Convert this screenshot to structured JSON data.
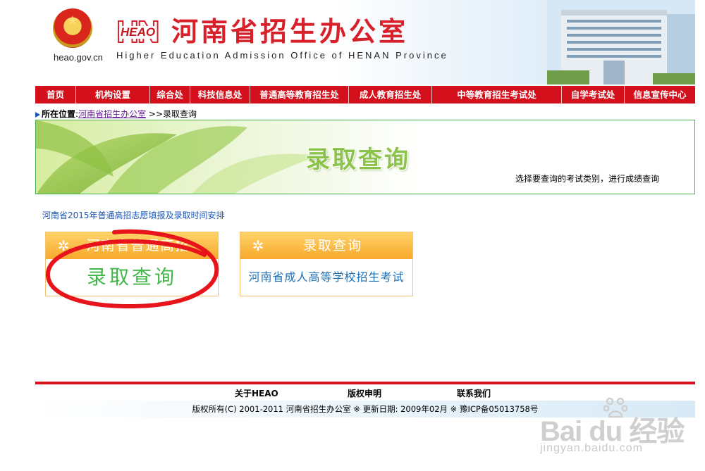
{
  "header": {
    "domain": "heao.gov.cn",
    "logo_text": "HEAO",
    "title": "河南省招生办公室",
    "subtitle": "Higher Education Admission Office of HENAN Province"
  },
  "nav": {
    "items": [
      {
        "label": "首页"
      },
      {
        "label": "机构设置"
      },
      {
        "label": "综合处"
      },
      {
        "label": "科技信息处"
      },
      {
        "label": "普通高等教育招生处"
      },
      {
        "label": "成人教育招生处"
      },
      {
        "label": "中等教育招生考试处"
      },
      {
        "label": "自学考试处"
      },
      {
        "label": "信息宣传中心"
      }
    ]
  },
  "breadcrumb": {
    "label": "所在位置",
    "home_link": "河南省招生办公室",
    "current": "录取查询"
  },
  "banner": {
    "title": "录取查询",
    "hint": "选择要查询的考试类别，进行成绩查询"
  },
  "notice": {
    "link": "河南省2015年普通高招志愿填报及录取时间安排"
  },
  "cards": [
    {
      "header": "河南省普通高招",
      "body": "录取查询"
    },
    {
      "header": "录取查询",
      "body": "河南省成人高等学校招生考试"
    }
  ],
  "footer": {
    "about": "关于HEAO",
    "copyright_link": "版权申明",
    "contact": "联系我们",
    "copyright": "版权所有(C) 2001-2011 河南省招生办公室 ※ 更新日期: 2009年02月 ※ 豫ICP备05013758号"
  },
  "watermark": {
    "brand": "Bai du 经验",
    "url": "jingyan.baidu.com"
  },
  "colors": {
    "nav_red": "#d3101b",
    "title_red": "#d7202a",
    "banner_green": "#8bc34a",
    "card_orange": "#f7a92b",
    "link_blue": "#1a56b5",
    "annotation_red": "#e8141c"
  }
}
